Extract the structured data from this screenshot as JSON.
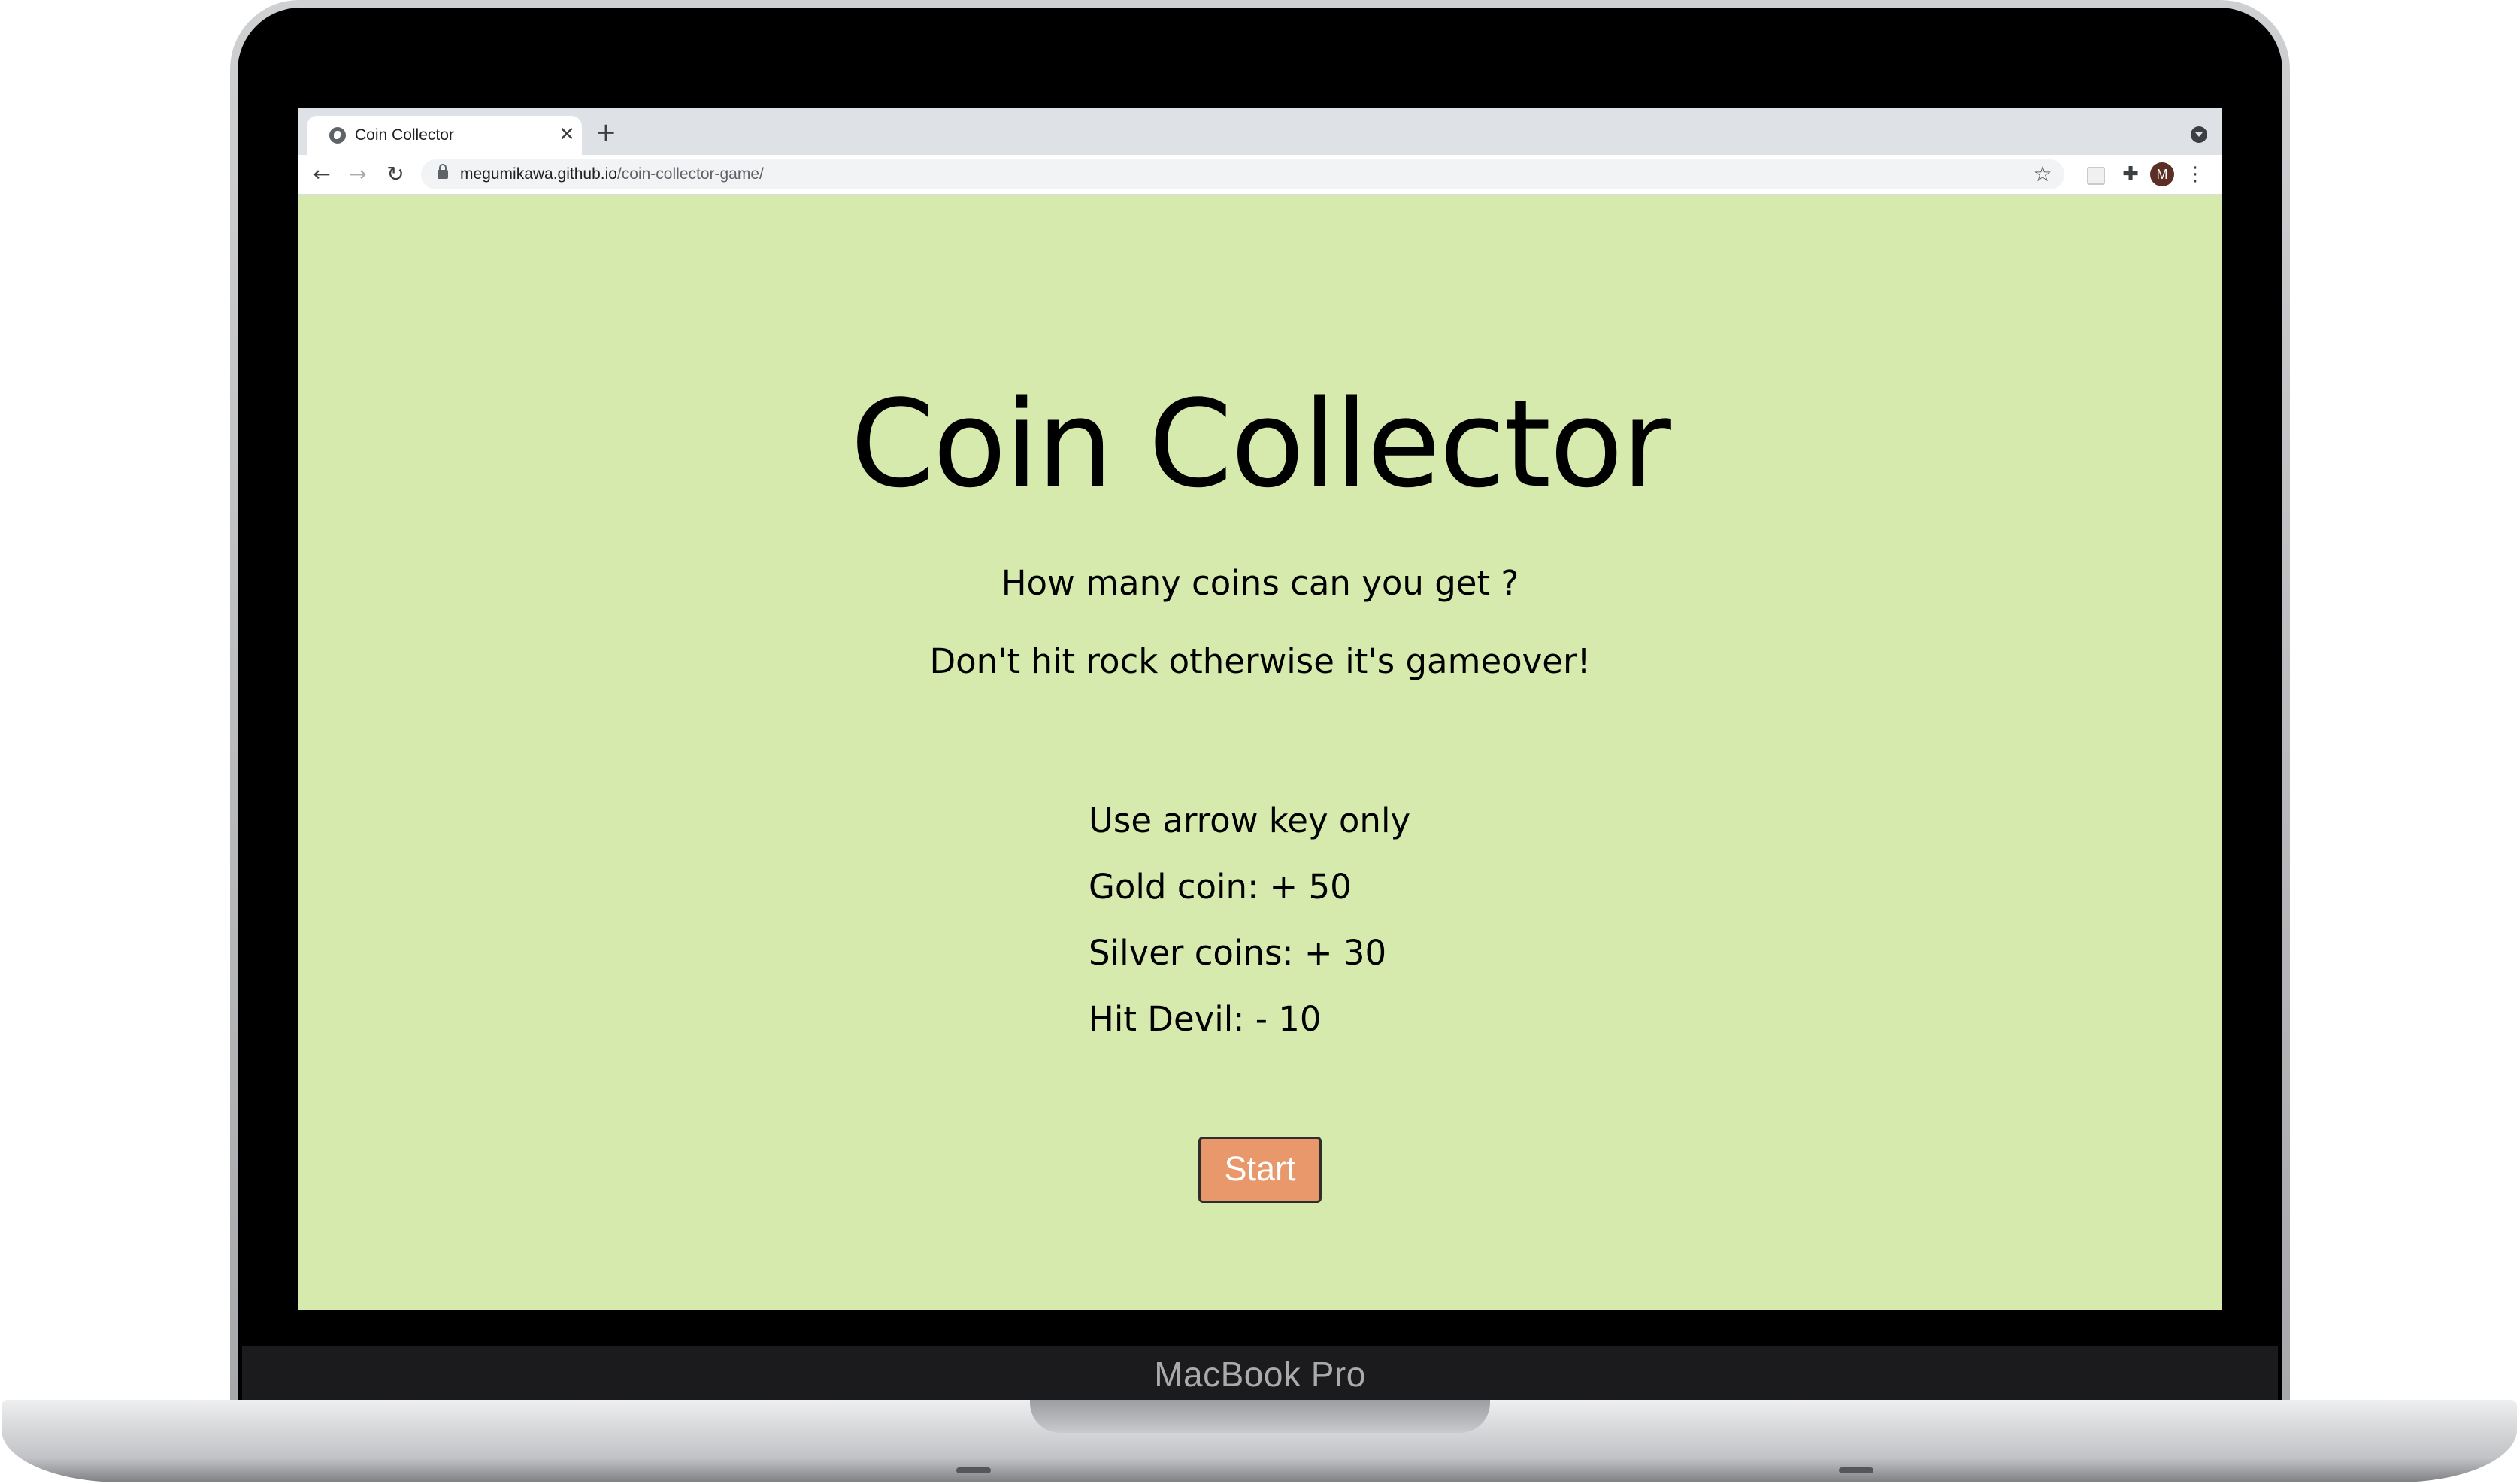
{
  "device": {
    "brand_label": "MacBook Pro"
  },
  "browser": {
    "tab": {
      "title": "Coin Collector",
      "favicon": "globe-icon",
      "close_glyph": "✕"
    },
    "new_tab_glyph": "+",
    "address_bar": {
      "host": "megumikawa.github.io",
      "path": "/coin-collector-game/"
    },
    "nav": {
      "back_glyph": "←",
      "forward_glyph": "→",
      "reload_glyph": "↻"
    },
    "star_glyph": "☆",
    "extensions_glyph": "✚",
    "avatar_letter": "M",
    "menu_glyph": "⋮"
  },
  "page": {
    "title": "Coin Collector",
    "taglines": [
      "How many coins can you get ?",
      "Don't hit rock otherwise it's gameover!"
    ],
    "rules": [
      "Use arrow key only",
      "Gold coin: + 50",
      "Silver coins: + 30",
      "Hit Devil: - 10"
    ],
    "start_label": "Start"
  },
  "colors": {
    "page_background": "#d6eaae",
    "start_button": "#e8986a",
    "avatar": "#5b2e26"
  }
}
